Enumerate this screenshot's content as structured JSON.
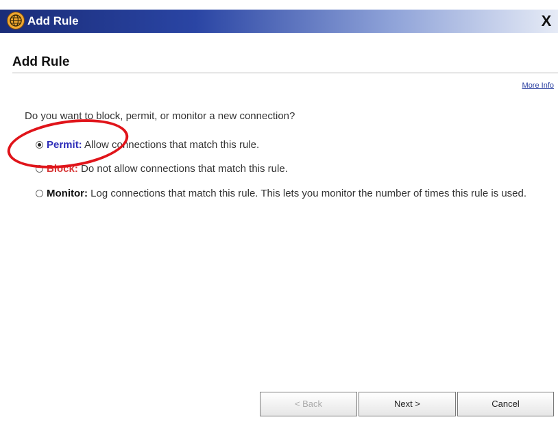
{
  "window": {
    "title": "Add Rule",
    "close_label": "X"
  },
  "page": {
    "heading": "Add Rule",
    "more_info": "More Info",
    "question": "Do you want to block, permit, or monitor a new connection?"
  },
  "options": [
    {
      "keyword": "Permit:",
      "description": "Allow connections that match this rule.",
      "selected": true
    },
    {
      "keyword": "Block:",
      "description": "Do not allow connections that match this rule.",
      "selected": false
    },
    {
      "keyword": "Monitor:",
      "description": "Log connections that match this rule. This lets you monitor the number of times this rule is used.",
      "selected": false
    }
  ],
  "buttons": {
    "back": "< Back",
    "next": "Next >",
    "cancel": "Cancel"
  },
  "colors": {
    "permit_keyword": "#2c2cb8",
    "block_keyword": "#d83838",
    "annotation": "#e0141a"
  }
}
